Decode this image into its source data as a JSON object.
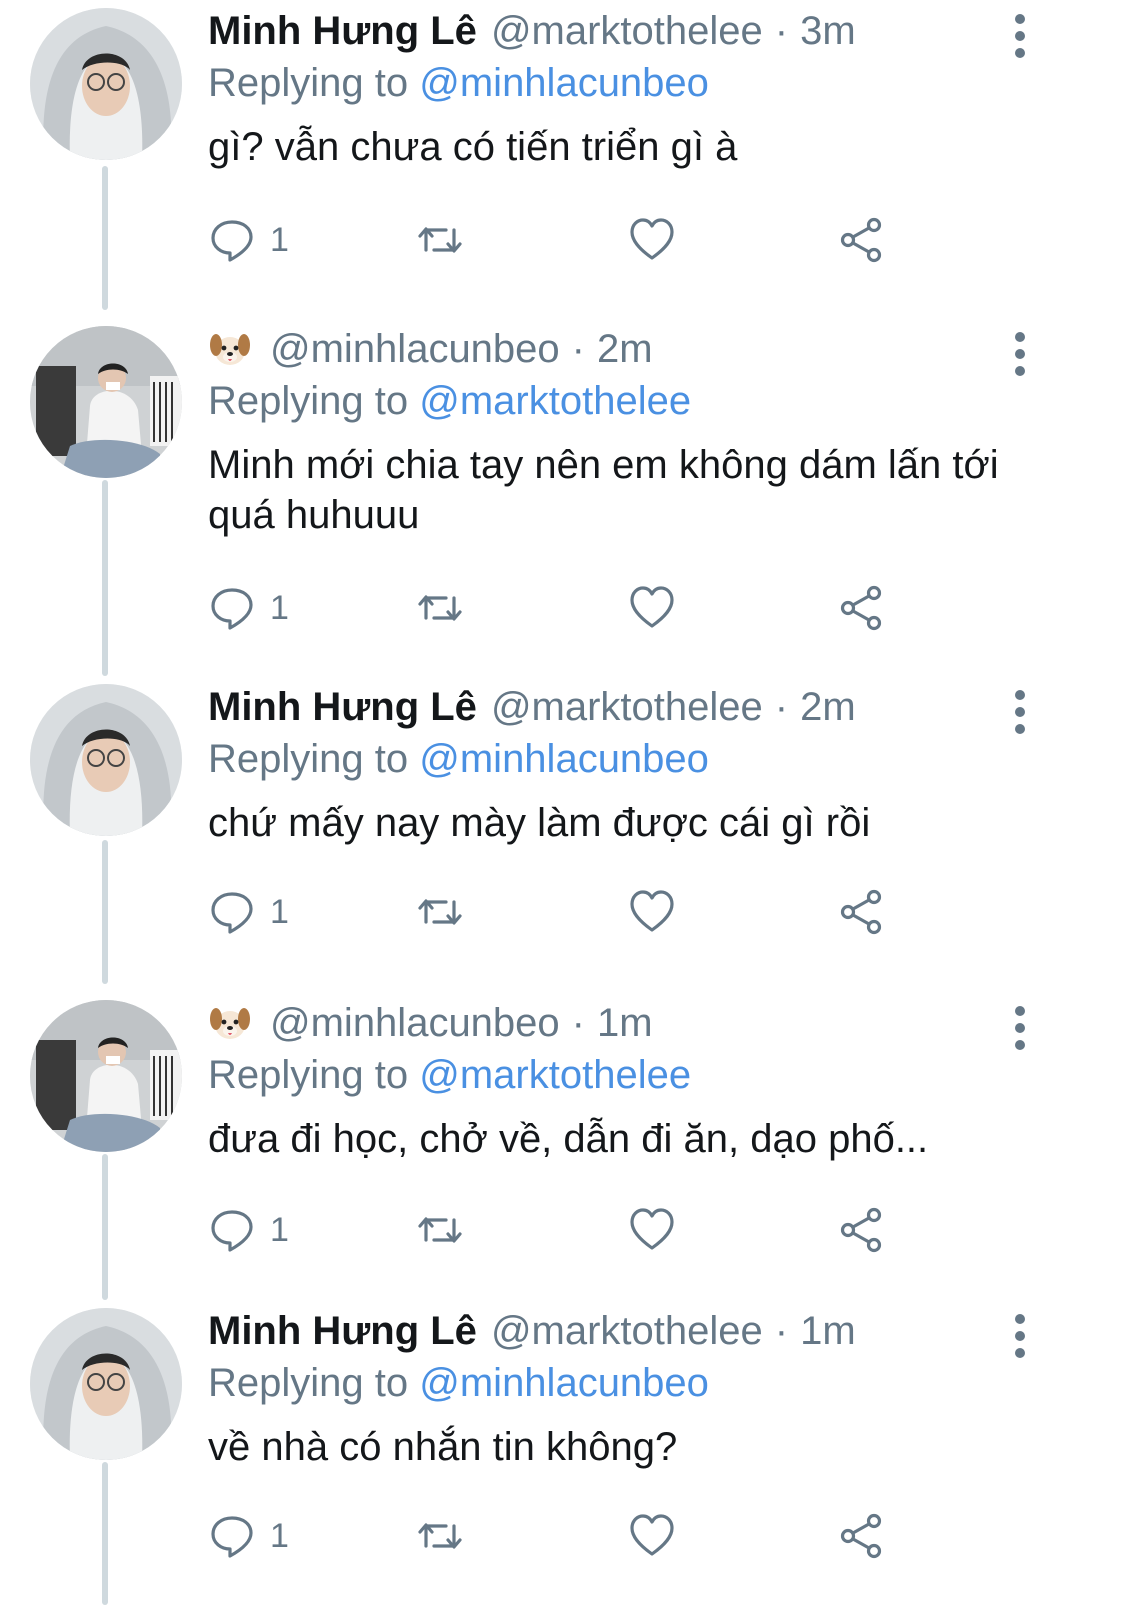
{
  "colors": {
    "text": "#14171a",
    "muted": "#657786",
    "link": "#4a90e2",
    "thread_line": "#cfd9de"
  },
  "icons": {
    "reply": "speech-bubble-icon",
    "retweet": "retweet-arrows-icon",
    "like": "heart-outline-icon",
    "share": "share-nodes-icon",
    "more": "vertical-ellipsis-icon",
    "dog": "dog-face-emoji"
  },
  "tweets": [
    {
      "name": "Minh Hưng Lê",
      "handle": "@marktothelee",
      "separator": "·",
      "time": "3m",
      "replying_prefix": "Replying to",
      "replying_to": "@minhlacunbeo",
      "text": "gì? vẫn chưa có tiến triển gì à",
      "reply_count": "1"
    },
    {
      "name": "",
      "handle": "@minhlacunbeo",
      "separator": "·",
      "time": "2m",
      "replying_prefix": "Replying to",
      "replying_to": "@marktothelee",
      "text": "Minh mới chia tay nên em không dám lấn tới quá huhuuu",
      "reply_count": "1"
    },
    {
      "name": "Minh Hưng Lê",
      "handle": "@marktothelee",
      "separator": "·",
      "time": "2m",
      "replying_prefix": "Replying to",
      "replying_to": "@minhlacunbeo",
      "text": "chứ mấy nay mày làm được cái gì rồi",
      "reply_count": "1"
    },
    {
      "name": "",
      "handle": "@minhlacunbeo",
      "separator": "·",
      "time": "1m",
      "replying_prefix": "Replying to",
      "replying_to": "@marktothelee",
      "text": "đưa đi học, chở về, dẫn đi ăn, dạo phố...",
      "reply_count": "1"
    },
    {
      "name": "Minh Hưng Lê",
      "handle": "@marktothelee",
      "separator": "·",
      "time": "1m",
      "replying_prefix": "Replying to",
      "replying_to": "@minhlacunbeo",
      "text": "về nhà có nhắn tin không?",
      "reply_count": "1"
    }
  ]
}
